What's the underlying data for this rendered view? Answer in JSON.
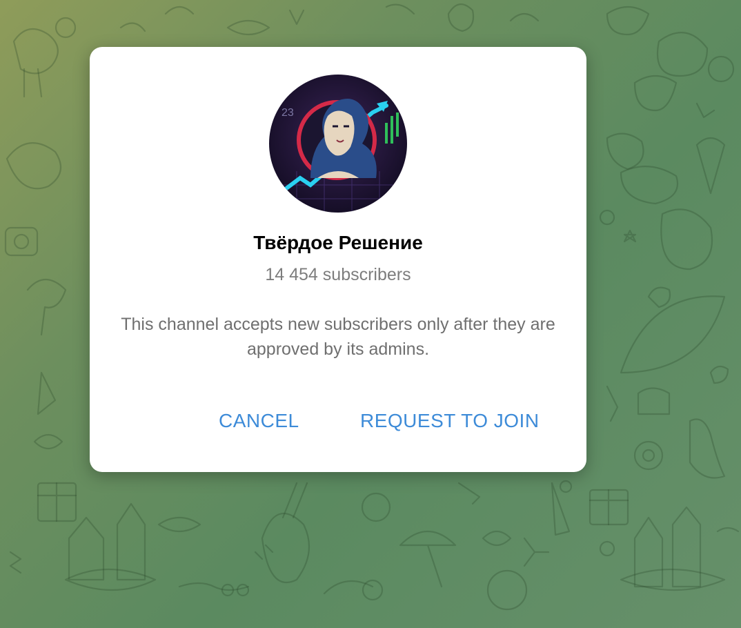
{
  "dialog": {
    "channel_name": "Твёрдое Решение",
    "subscribers": "14 454 subscribers",
    "description": "This channel accepts new subscribers only after they are approved by its admins.",
    "cancel_label": "CANCEL",
    "join_label": "REQUEST TO JOIN",
    "avatar_icon": "channel-avatar-portrait"
  },
  "colors": {
    "accent": "#3d8bd8",
    "title": "#000000",
    "secondary_text": "#7d7d7d",
    "dialog_bg": "#ffffff"
  }
}
